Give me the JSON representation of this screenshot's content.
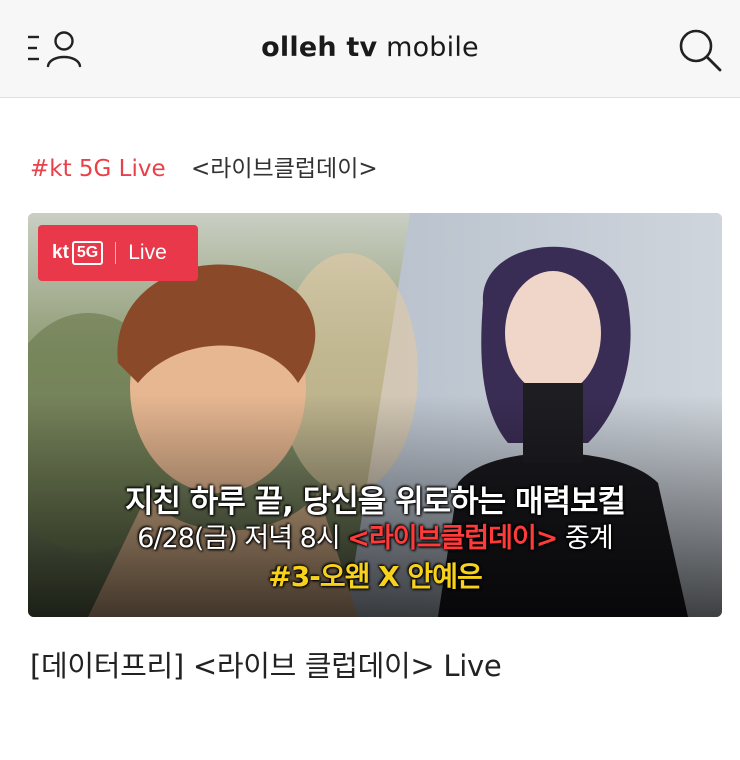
{
  "header": {
    "title_bold": "olleh tv",
    "title_rest": "mobile",
    "menu_icon": "menu-profile-icon",
    "search_icon": "search-icon"
  },
  "tagline": {
    "hashtag": "#kt 5G Live",
    "program": "<라이브클럽데이>"
  },
  "thumbnail": {
    "badge": {
      "kt": "kt",
      "g5": "5G",
      "live": "Live"
    },
    "line1": "지친 하루 끝, 당신을 위로하는 매력보컬",
    "line2_pre": "6/28(금) 저녁 8시 ",
    "line2_highlight": "<라이브클럽데이>",
    "line2_post": " 중계",
    "line3": "#3-오왠 X 안예은"
  },
  "video": {
    "title": "[데이터프리] <라이브 클럽데이> Live"
  },
  "colors": {
    "accent": "#e8414a",
    "badge_bg": "#e8384a",
    "highlight_yellow": "#f7d11c",
    "header_bg": "#f7f7f7"
  }
}
